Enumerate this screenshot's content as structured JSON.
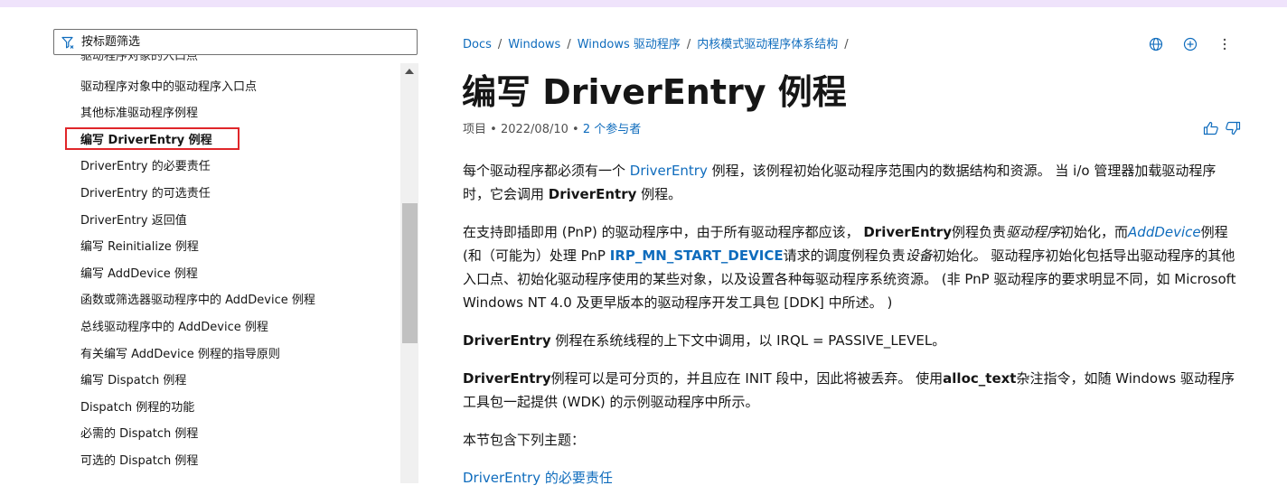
{
  "sidebar": {
    "filter_placeholder": "按标题筛选",
    "items": [
      {
        "label": "驱动程序对象中的驱动程序入口点"
      },
      {
        "label": "其他标准驱动程序例程"
      },
      {
        "label": "编写 DriverEntry 例程"
      },
      {
        "label": "DriverEntry 的必要责任"
      },
      {
        "label": "DriverEntry 的可选责任"
      },
      {
        "label": "DriverEntry 返回值"
      },
      {
        "label": "编写 Reinitialize 例程"
      },
      {
        "label": "编写 AddDevice 例程"
      },
      {
        "label": "函数或筛选器驱动程序中的 AddDevice 例程"
      },
      {
        "label": "总线驱动程序中的 AddDevice 例程"
      },
      {
        "label": "有关编写 AddDevice 例程的指导原则"
      },
      {
        "label": "编写 Dispatch 例程"
      },
      {
        "label": "Dispatch 例程的功能"
      },
      {
        "label": "必需的 Dispatch 例程"
      },
      {
        "label": "可选的 Dispatch 例程"
      }
    ]
  },
  "breadcrumb": [
    "Docs",
    "Windows",
    "Windows 驱动程序",
    "内核模式驱动程序体系结构"
  ],
  "breadcrumb_sep": "/",
  "page": {
    "title": "编写 DriverEntry 例程",
    "meta_prefix": "项目",
    "meta_dot": "•",
    "date": "2022/08/10",
    "contributors": "2 个参与者"
  },
  "content": {
    "p1": {
      "a": "每个驱动程序都必须有一个 ",
      "link": "DriverEntry",
      "b": " 例程，该例程初始化驱动程序范围内的数据结构和资源。 当 i/o 管理器加载驱动程序时，它会调用 ",
      "bold": "DriverEntry",
      "c": " 例程。"
    },
    "p2": {
      "a": "在支持即插即用 (PnP) 的驱动程序中，由于所有驱动程序都应该， ",
      "bold1": "DriverEntry",
      "b": "例程负责",
      "italic1": "驱动程序",
      "c": "初始化，而",
      "link1": "AddDevice",
      "d": "例程 (和（可能为）处理 PnP ",
      "link2": "IRP_MN_START_DEVICE",
      "e": "请求的调度例程负责",
      "italic2": "设备",
      "f": "初始化。 驱动程序初始化包括导出驱动程序的其他入口点、初始化驱动程序使用的某些对象，以及设置各种每驱动程序系统资源。 (非 PnP 驱动程序的要求明显不同，如 Microsoft Windows NT 4.0 及更早版本的驱动程序开发工具包 [DDK] 中所述。 )"
    },
    "p3": {
      "bold": "DriverEntry",
      "a": " 例程在系统线程的上下文中调用，以 IRQL = PASSIVE_LEVEL。"
    },
    "p4": {
      "bold1": "DriverEntry",
      "a": "例程可以是可分页的，并且应在 INIT 段中，因此将被丢弃。 使用",
      "bold2": "alloc_text",
      "b": "杂注指令，如随 Windows 驱动程序工具包一起提供 (WDK) 的示例驱动程序中所示。"
    },
    "p5": "本节包含下列主题：",
    "link_topic": "DriverEntry 的必要责任"
  },
  "colors": {
    "accent": "#0f6cbd",
    "highlight_border": "#e0262a",
    "top_band": "#efe3fb"
  }
}
